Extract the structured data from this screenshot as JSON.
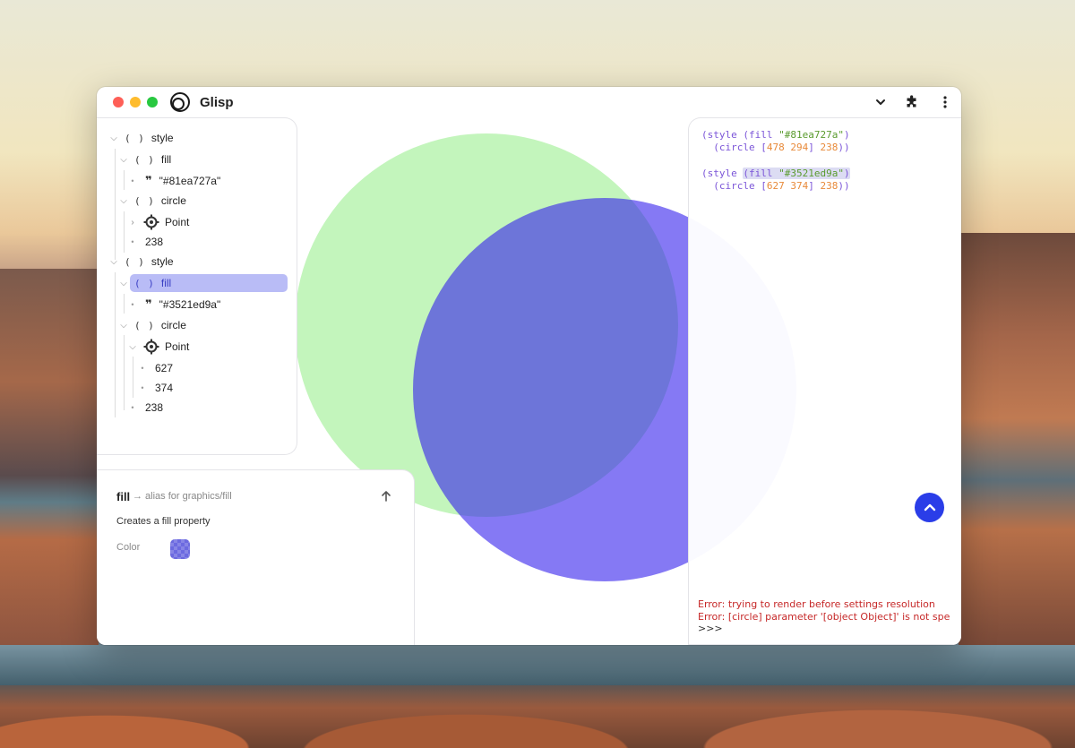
{
  "app": {
    "title": "Glisp"
  },
  "tree": {
    "rows": [
      {
        "label": "style",
        "kind": "list"
      },
      {
        "label": "fill",
        "kind": "list"
      },
      {
        "label": "\"#81ea727a\"",
        "kind": "string"
      },
      {
        "label": "circle",
        "kind": "list"
      },
      {
        "label": "Point",
        "kind": "point"
      },
      {
        "label": "238",
        "kind": "number"
      },
      {
        "label": "style",
        "kind": "list"
      },
      {
        "label": "fill",
        "kind": "list",
        "selected": true
      },
      {
        "label": "\"#3521ed9a\"",
        "kind": "string"
      },
      {
        "label": "circle",
        "kind": "list"
      },
      {
        "label": "Point",
        "kind": "point"
      },
      {
        "label": "627",
        "kind": "number"
      },
      {
        "label": "374",
        "kind": "number"
      },
      {
        "label": "238",
        "kind": "number"
      }
    ],
    "paren_glyph": "( )",
    "quote_glyph": "❞"
  },
  "doc": {
    "name": "fill",
    "alias": "→ alias for graphics/fill",
    "description": "Creates a fill property",
    "param_label": "Color",
    "swatch_color": "#3521ed9a"
  },
  "code": {
    "block1": {
      "open": "(style ",
      "fill_open": "(fill ",
      "color": "\"#81ea727a\"",
      "fill_close": ")",
      "circle_open": "  (circle [",
      "x": "478",
      "y": "294",
      "mid": "] ",
      "r": "238",
      "close": "))"
    },
    "block2": {
      "open": "(style ",
      "fill_open": "(fill ",
      "color": "\"#3521ed9a\"",
      "fill_close": ")",
      "circle_open": "  (circle [",
      "x": "627",
      "y": "374",
      "mid": "] ",
      "r": "238",
      "close": "))"
    }
  },
  "console": {
    "error1": "Error: trying to render before settings resolution",
    "error2": "Error: [circle] parameter '[object Object]' is not specified",
    "prompt": ">>>"
  },
  "colors": {
    "circle1": "#81ea727a",
    "circle2": "#3521ed9a",
    "selection": "#b9bcf6",
    "accent": "#2a3de8"
  }
}
